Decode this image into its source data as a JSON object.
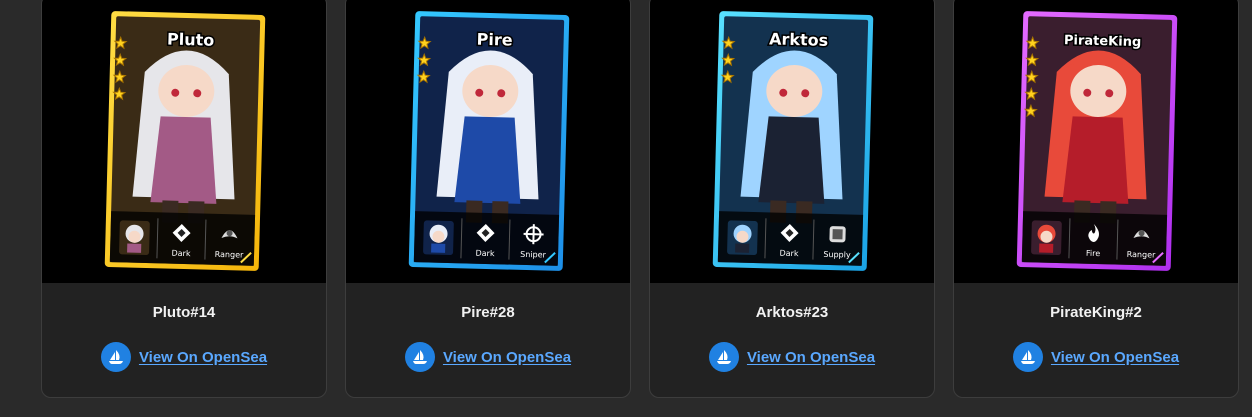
{
  "cards": [
    {
      "art_title": "Pluto",
      "name": "Pluto#14",
      "link_label": "View On OpenSea",
      "stars": 4,
      "element": "Dark",
      "role": "Ranger",
      "frame_color": "#f5b50a",
      "frame_color_2": "#ffdd44",
      "hair_color": "#e6e6ea",
      "outfit_color": "#a35a86",
      "bg_color": "#3a2b16",
      "element_icon": "dark-element-icon",
      "role_icon": "ranger-class-icon"
    },
    {
      "art_title": "Pire",
      "name": "Pire#28",
      "link_label": "View On OpenSea",
      "stars": 3,
      "element": "Dark",
      "role": "Sniper",
      "frame_color": "#1d8fe8",
      "frame_color_2": "#34c8ff",
      "hair_color": "#e9eef8",
      "outfit_color": "#1e4aa8",
      "bg_color": "#10234a",
      "element_icon": "dark-element-icon",
      "role_icon": "sniper-class-icon"
    },
    {
      "art_title": "Arktos",
      "name": "Arktos#23",
      "link_label": "View On OpenSea",
      "stars": 3,
      "element": "Dark",
      "role": "Supply",
      "frame_color": "#1aa3e6",
      "frame_color_2": "#59e1ff",
      "hair_color": "#9fd4ff",
      "outfit_color": "#1b2233",
      "bg_color": "#13324f",
      "element_icon": "dark-element-icon",
      "role_icon": "supply-class-icon"
    },
    {
      "art_title": "PirateKing",
      "name": "PirateKing#2",
      "link_label": "View On OpenSea",
      "stars": 5,
      "element": "Fire",
      "role": "Ranger",
      "frame_color": "#b02ff0",
      "frame_color_2": "#e46bff",
      "hair_color": "#e84a3a",
      "outfit_color": "#b51d2a",
      "bg_color": "#3a1e2e",
      "element_icon": "fire-element-icon",
      "role_icon": "ranger-class-icon"
    }
  ]
}
